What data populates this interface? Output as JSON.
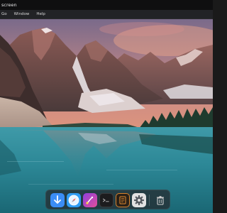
{
  "window": {
    "title": "screen"
  },
  "menubar": {
    "items": [
      {
        "label": "Go"
      },
      {
        "label": "Window"
      },
      {
        "label": "Help"
      }
    ]
  },
  "desktop": {
    "wallpaper": "mountain-lake-sunset"
  },
  "dock": {
    "apps": [
      {
        "name": "downloads",
        "icon": "download-arrow-icon",
        "color": "#3b8df5"
      },
      {
        "name": "safari",
        "icon": "compass-icon",
        "color": "#2f9cf3"
      },
      {
        "name": "creative-app",
        "icon": "brush-icon",
        "color": "#c44cdc"
      },
      {
        "name": "terminal",
        "icon": "terminal-icon",
        "color": "#1c1c1e"
      },
      {
        "name": "notes-app",
        "icon": "notebook-icon",
        "color": "#d9822b"
      },
      {
        "name": "settings",
        "icon": "gear-icon",
        "color": "#dcdcdc"
      },
      {
        "name": "trash",
        "icon": "trash-icon",
        "color": "#2a2b2e"
      }
    ]
  }
}
